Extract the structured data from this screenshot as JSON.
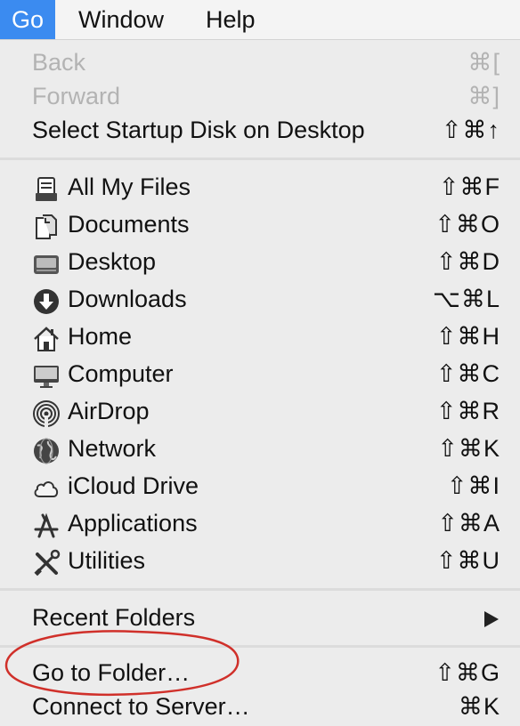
{
  "menubar": {
    "go": "Go",
    "window": "Window",
    "help": "Help"
  },
  "menu": {
    "back": {
      "label": "Back",
      "shortcut": "⌘["
    },
    "forward": {
      "label": "Forward",
      "shortcut": "⌘]"
    },
    "startup": {
      "label": "Select Startup Disk on Desktop",
      "shortcut": "⇧⌘↑"
    },
    "places": [
      {
        "label": "All My Files",
        "shortcut": "⇧⌘F",
        "icon": "all-my-files-icon"
      },
      {
        "label": "Documents",
        "shortcut": "⇧⌘O",
        "icon": "documents-icon"
      },
      {
        "label": "Desktop",
        "shortcut": "⇧⌘D",
        "icon": "desktop-icon"
      },
      {
        "label": "Downloads",
        "shortcut": "⌥⌘L",
        "icon": "downloads-icon"
      },
      {
        "label": "Home",
        "shortcut": "⇧⌘H",
        "icon": "home-icon"
      },
      {
        "label": "Computer",
        "shortcut": "⇧⌘C",
        "icon": "computer-icon"
      },
      {
        "label": "AirDrop",
        "shortcut": "⇧⌘R",
        "icon": "airdrop-icon"
      },
      {
        "label": "Network",
        "shortcut": "⇧⌘K",
        "icon": "network-icon"
      },
      {
        "label": "iCloud Drive",
        "shortcut": "⇧⌘I",
        "icon": "icloud-icon"
      },
      {
        "label": "Applications",
        "shortcut": "⇧⌘A",
        "icon": "applications-icon"
      },
      {
        "label": "Utilities",
        "shortcut": "⇧⌘U",
        "icon": "utilities-icon"
      }
    ],
    "recent": {
      "label": "Recent Folders"
    },
    "goto": {
      "label": "Go to Folder…",
      "shortcut": "⇧⌘G"
    },
    "connect": {
      "label": "Connect to Server…",
      "shortcut": "⌘K"
    }
  },
  "colors": {
    "highlight": "#3b8bf0",
    "annotation": "#d0302a"
  }
}
